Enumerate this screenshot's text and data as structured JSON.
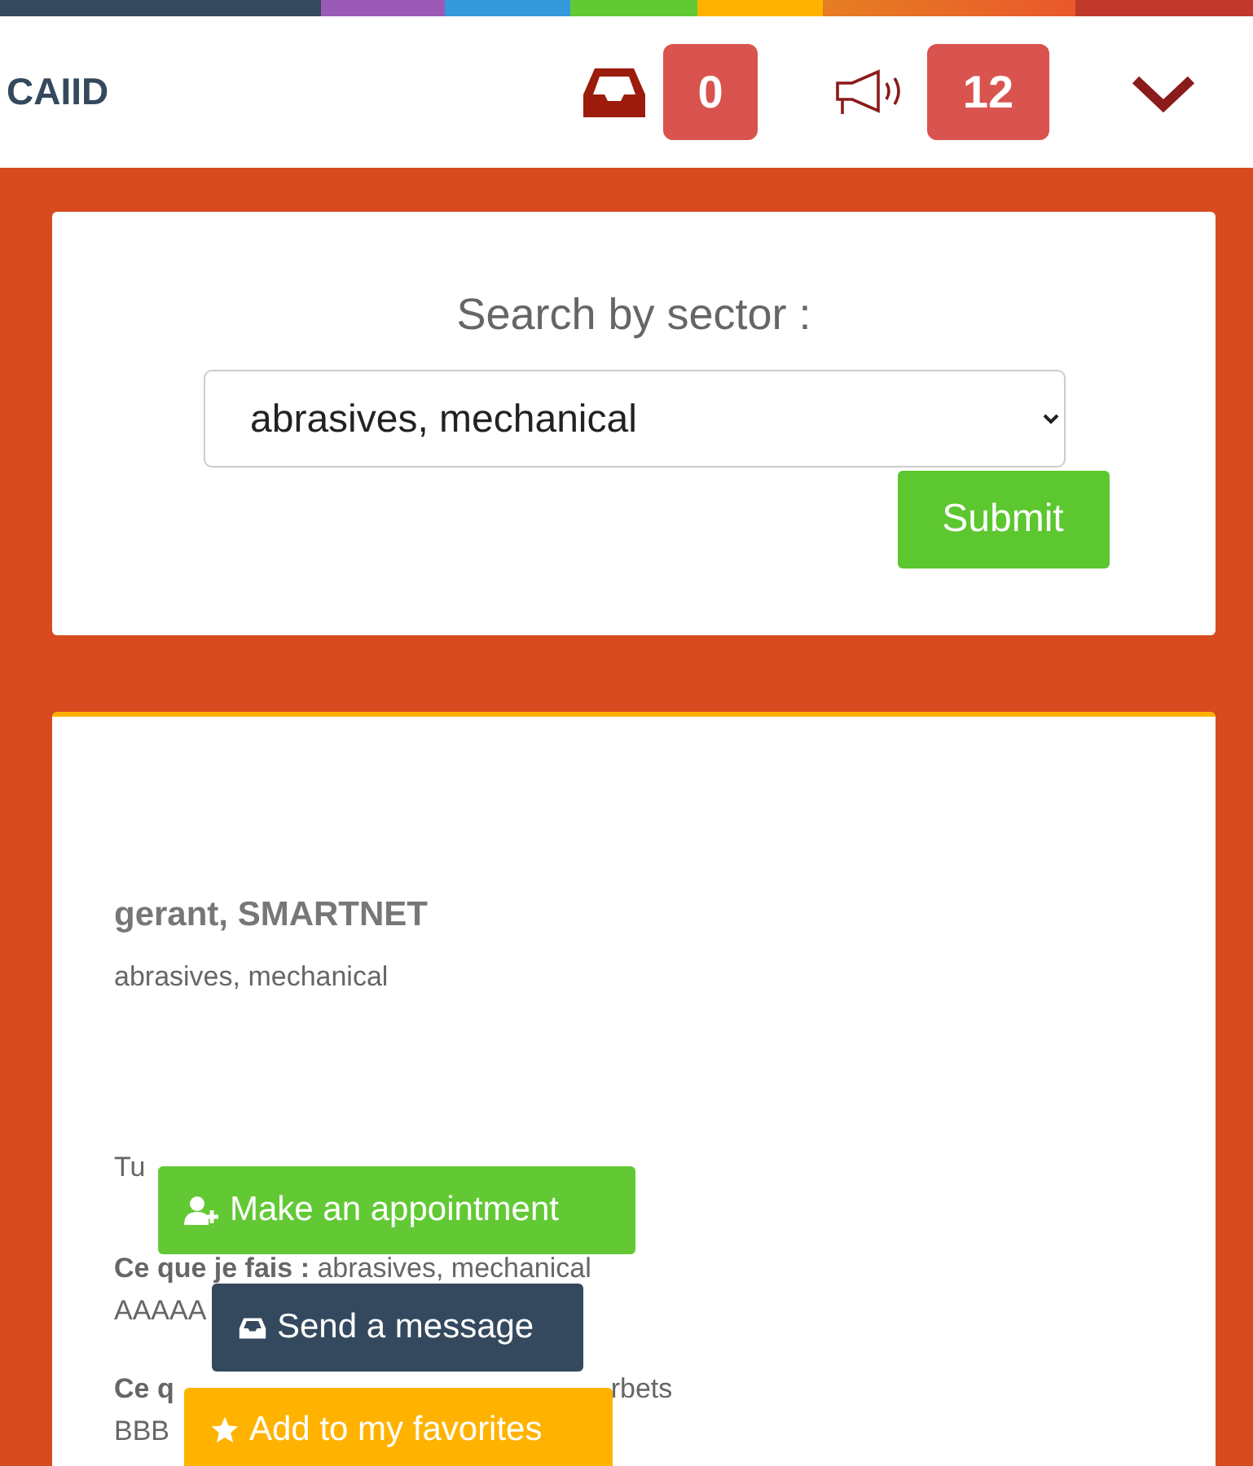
{
  "header": {
    "brand": "CAIID",
    "inbox_count": "0",
    "notification_count": "12"
  },
  "search": {
    "label": "Search by sector :",
    "value": "abrasives, mechanical",
    "submit": "Submit"
  },
  "result": {
    "name": "gerant, SMARTNET",
    "sector": "abrasives, mechanical",
    "country": "Tu",
    "what_i_do": "**Ce que je fais :** abrasives, mechanical",
    "what_i_do_detail": "AAAAA",
    "looking_for_start": "Ce q",
    "looking_for_end": "rbets",
    "looking_for_detail": "BBB"
  },
  "actions": [
    {
      "kind": "appointment",
      "label": "Make an appointment"
    },
    {
      "kind": "message",
      "label": "Send a message"
    },
    {
      "kind": "favorite",
      "label": "Add to my favorites"
    }
  ]
}
